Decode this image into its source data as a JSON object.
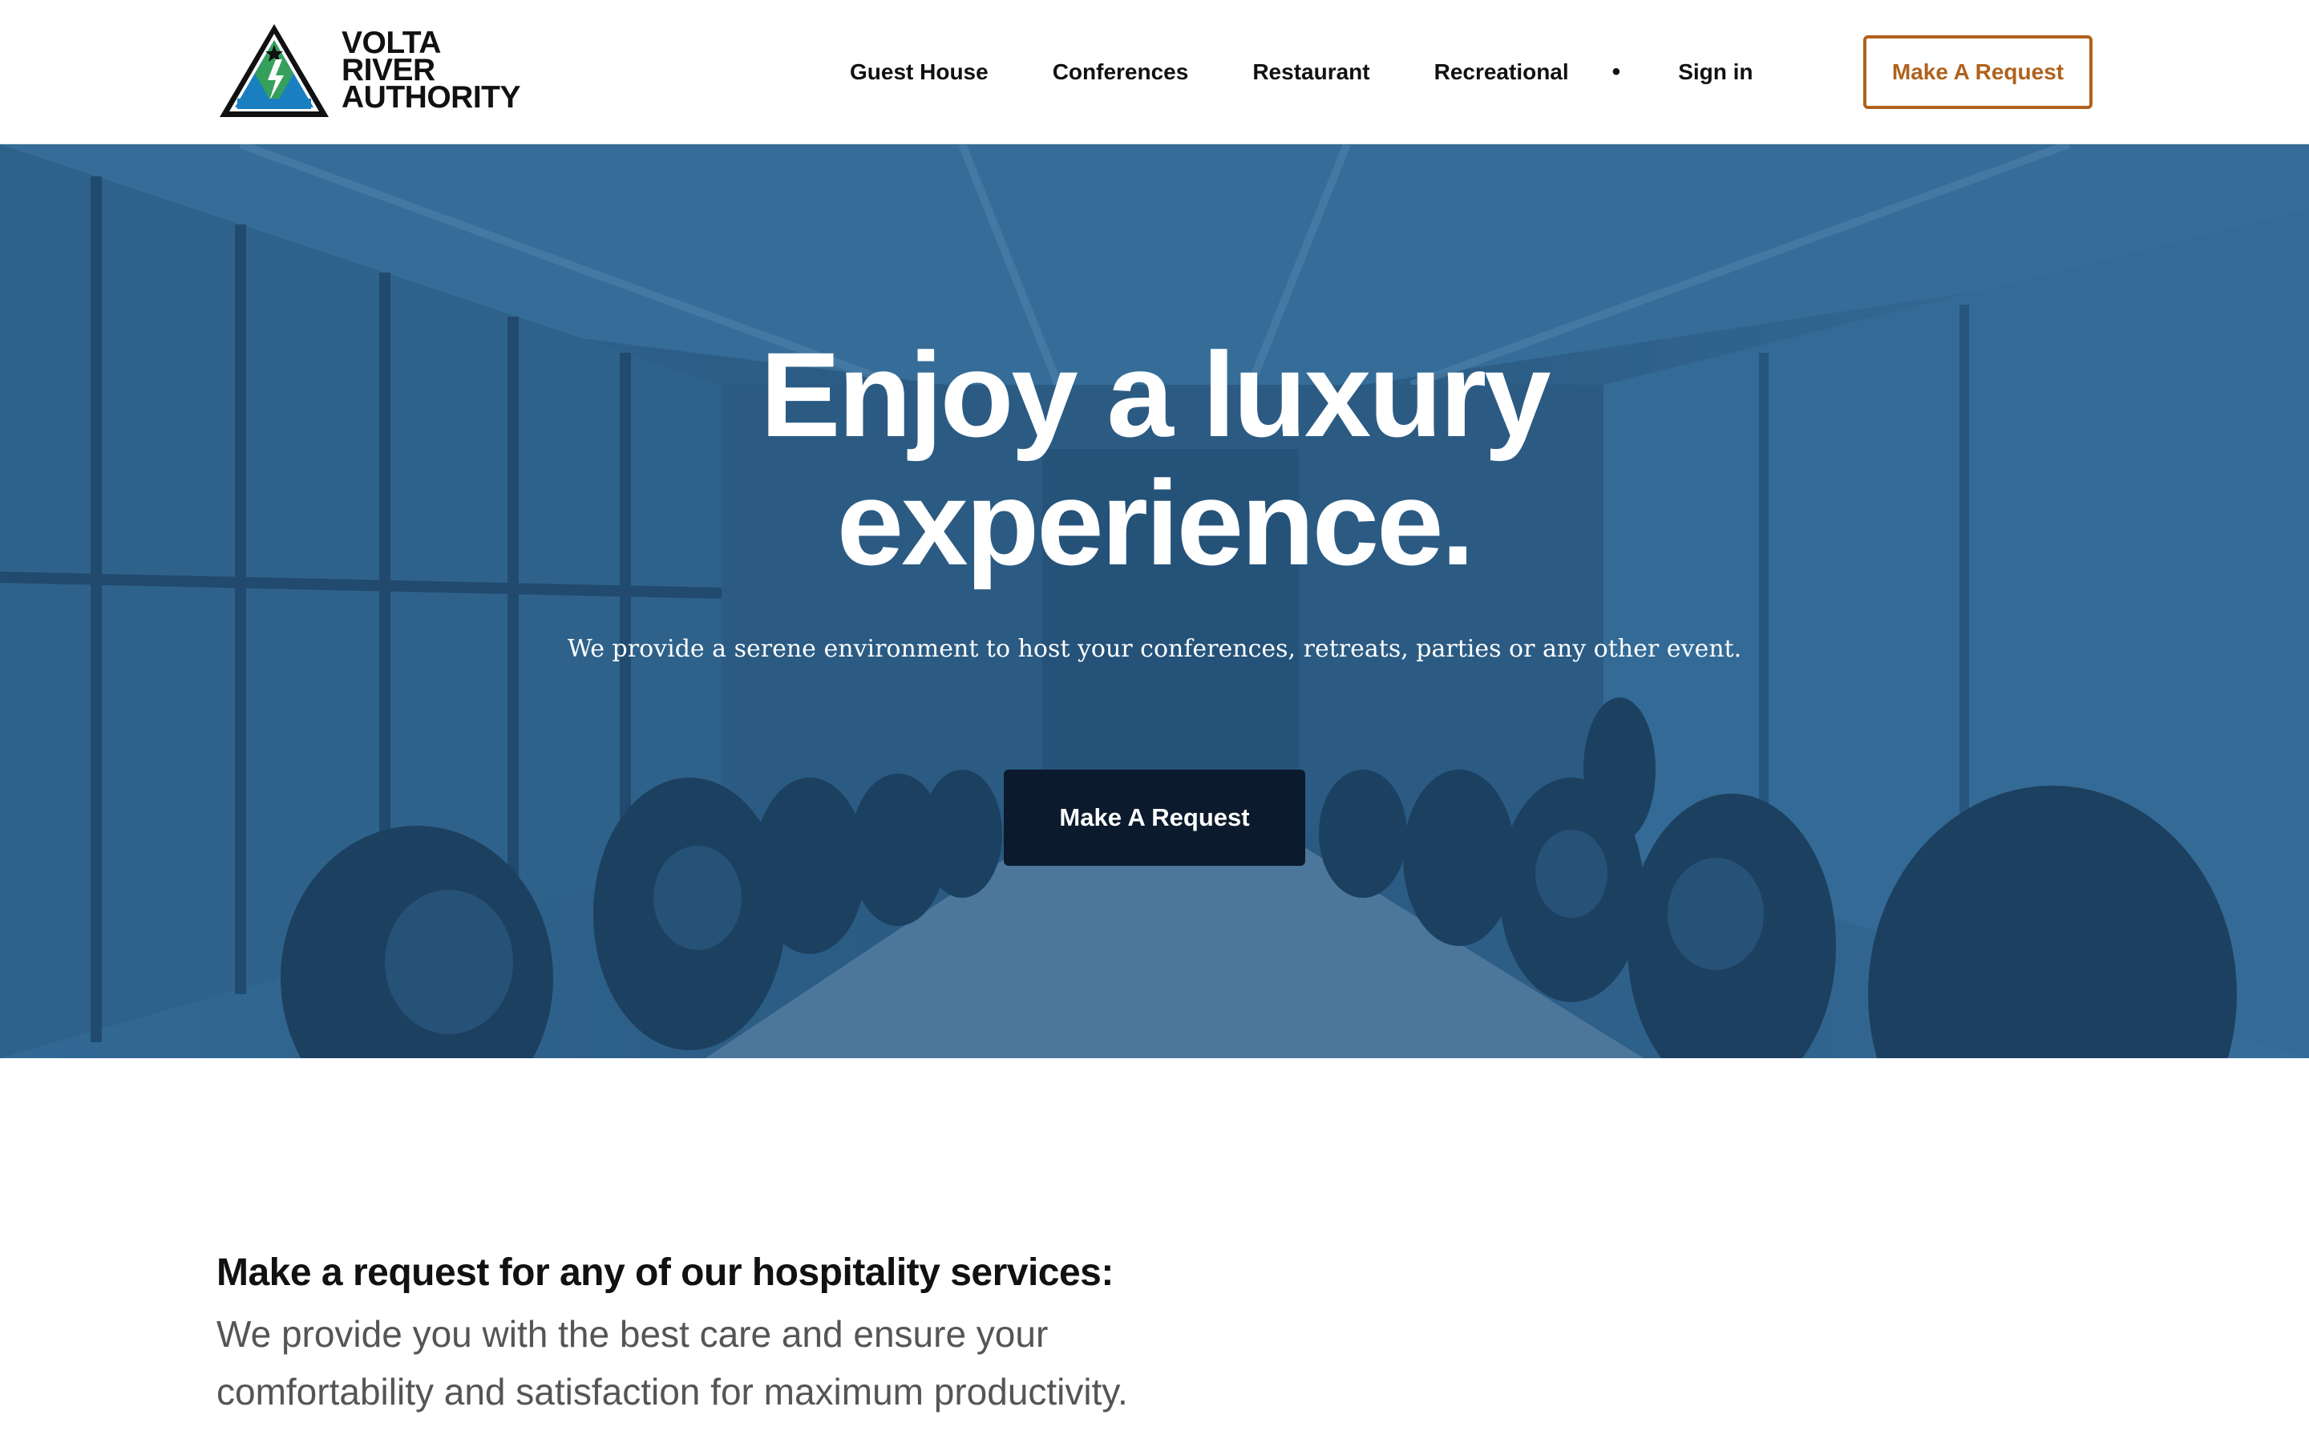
{
  "header": {
    "logo": {
      "line1": "VOLTA",
      "line2": "RIVER",
      "line3": "AUTHORITY",
      "emblem_text": "VOLTA RIVER AUTHORITY"
    },
    "nav": {
      "items": [
        {
          "label": "Guest House"
        },
        {
          "label": "Conferences"
        },
        {
          "label": "Restaurant"
        },
        {
          "label": "Recreational"
        }
      ],
      "separator": "•",
      "signin_label": "Sign in",
      "cta_label": "Make A Request"
    }
  },
  "hero": {
    "title_line1": "Enjoy a luxury",
    "title_line2": "experience.",
    "subtitle": "We provide a serene environment to host your conferences, retreats, parties or any other event.",
    "cta_label": "Make A Request"
  },
  "intro": {
    "heading": "Make a request for any of our hospitality services:",
    "body": "We provide you with the best care and ensure your comfortability and satisfaction for maximum productivity."
  },
  "colors": {
    "accent": "#b0621d",
    "hero_overlay": "#2c5f88",
    "hero_button": "#0b1a2c",
    "logo_blue": "#1a7fc1",
    "logo_green": "#3aa64a"
  },
  "icons": {
    "logo_emblem": "triangle-logo-icon",
    "hero_background": "conference-room-photo"
  }
}
